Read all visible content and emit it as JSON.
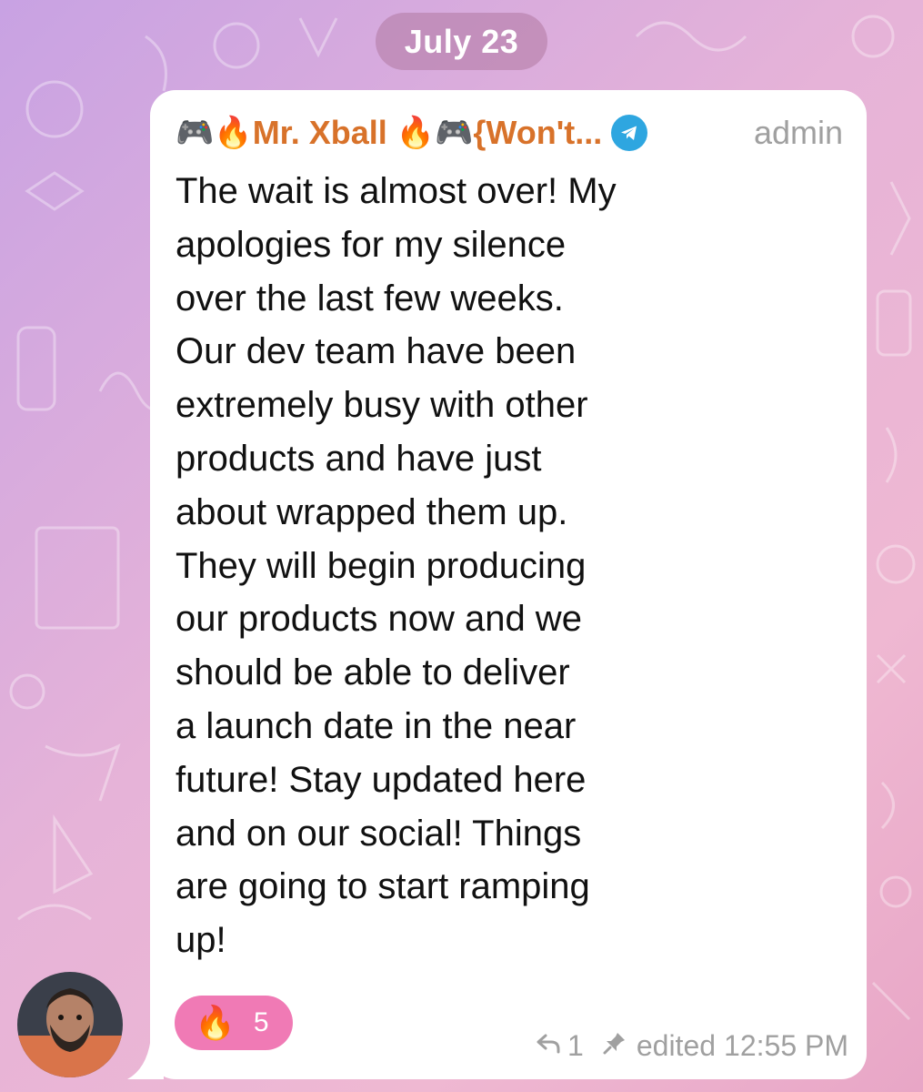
{
  "date_separator": "July 23",
  "message": {
    "sender": {
      "name": "Mr. Xball",
      "name_suffix": "{Won't...",
      "role": "admin"
    },
    "lines": [
      "The wait is almost over! My",
      "apologies for my silence",
      "over the last few weeks.",
      "Our dev team have been",
      "extremely busy with other",
      "products and have just",
      "about wrapped them up.",
      "They will begin producing",
      "our products now and we",
      "should be able to deliver",
      "a launch date in the near",
      "future! Stay updated here",
      "and on our social! Things",
      "are going to start ramping",
      "up!"
    ],
    "reaction": {
      "emoji": "fire-icon",
      "count": "5"
    },
    "replies": "1",
    "edited_label": "edited",
    "time": "12:55 PM"
  },
  "colors": {
    "sender_name": "#d8722a",
    "reaction_bg": "#f07ab5",
    "telegram_badge": "#2ea6e0",
    "meta_text": "#a0a0a0"
  }
}
